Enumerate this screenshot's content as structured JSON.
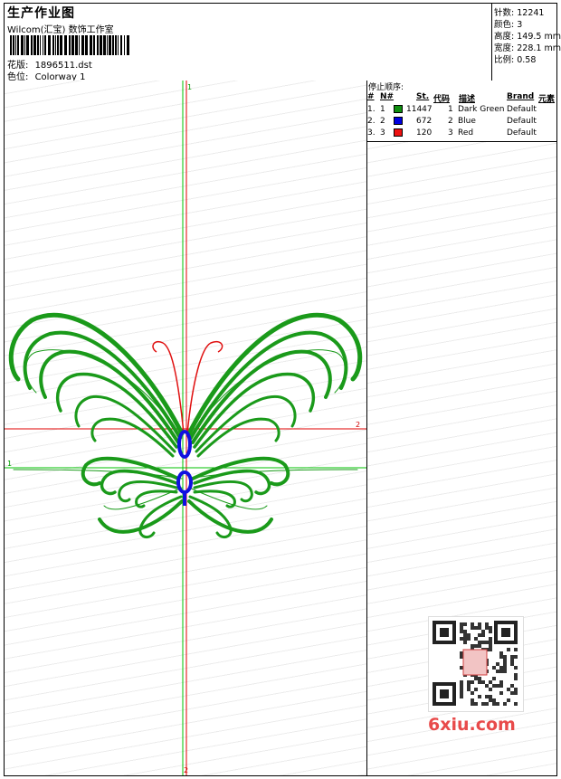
{
  "header": {
    "title": "生产作业图",
    "subtitle": "Wilcom(汇宝) 数饰工作室",
    "design_label": "花版:",
    "design_value": "1896511.dst",
    "colorway_label": "色位:",
    "colorway_value": "Colorway 1"
  },
  "stats": {
    "stitches_label": "针数:",
    "stitches_value": "12241",
    "colors_label": "颜色:",
    "colors_value": "3",
    "height_label": "高度:",
    "height_value": "149.5 mm",
    "width_label": "宽度:",
    "width_value": "228.1 mm",
    "scale_label": "比例:",
    "scale_value": "0.58"
  },
  "stop_sequence": {
    "heading": "停止顺序:",
    "columns": [
      "#",
      "N#",
      "St.",
      "代码",
      "描述",
      "Brand",
      "元素"
    ],
    "rows": [
      {
        "idx": "1.",
        "n": "1",
        "color": "#0f8f0f",
        "st": "11447",
        "code": "1",
        "desc": "Dark Green",
        "brand": "Default"
      },
      {
        "idx": "2.",
        "n": "2",
        "color": "#0000e0",
        "st": "672",
        "code": "2",
        "desc": "Blue",
        "brand": "Default"
      },
      {
        "idx": "3.",
        "n": "3",
        "color": "#ee1111",
        "st": "120",
        "code": "3",
        "desc": "Red",
        "brand": "Default"
      }
    ]
  },
  "markers": {
    "top": "1",
    "right": "2",
    "left": "1",
    "bottom": "2"
  },
  "colors": {
    "green": "#1a9a1a",
    "blue": "#1010e0",
    "red": "#e01010",
    "guide_green": "#00c000",
    "guide_red": "#e00000"
  },
  "watermark": {
    "brand": "6xiu.com",
    "seal": "印图图标"
  }
}
